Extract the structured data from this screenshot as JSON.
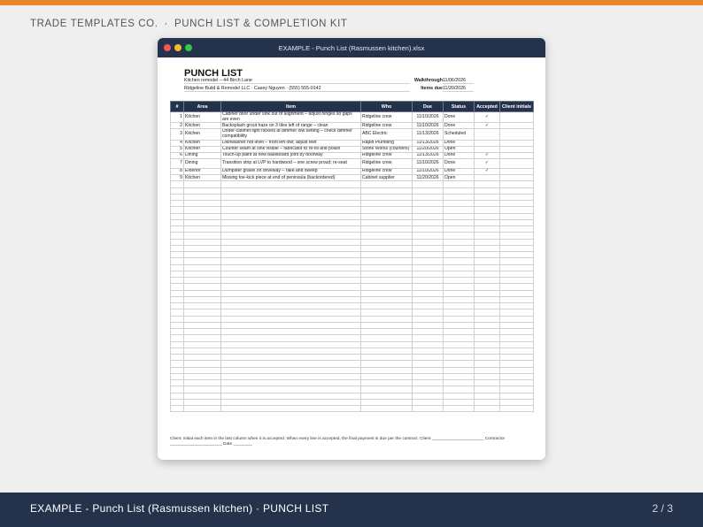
{
  "header": {
    "brand": "TRADE TEMPLATES CO.",
    "separator": "·",
    "kit": "PUNCH LIST & COMPLETION KIT"
  },
  "window": {
    "title": "EXAMPLE - Punch List (Rasmussen kitchen).xlsx"
  },
  "sheet": {
    "title": "PUNCH LIST",
    "project": "Kitchen remodel – 44 Birch Lane",
    "contractor": "Ridgeline Build & Remodel LLC  ·  Casey Nguyen · (555) 555-0142",
    "walkthrough_label": "Walkthrough",
    "walkthrough_value": "11/06/2026",
    "items_due_label": "Items due",
    "items_due_value": "11/20/2026",
    "columns": [
      "#",
      "Area",
      "Item",
      "Who",
      "Due",
      "Status",
      "Accepted",
      "Client initials"
    ],
    "rows": [
      {
        "num": "1",
        "area": "Kitchen",
        "item": "Cabinet door under sink out of alignment – adjust hinges so gaps are even",
        "who": "Ridgeline crew",
        "due": "11/10/2026",
        "status": "Done",
        "accepted": "✓",
        "initials": ""
      },
      {
        "num": "2",
        "area": "Kitchen",
        "item": "Backsplash grout haze on 3 tiles left of range – clean",
        "who": "Ridgeline crew",
        "due": "11/10/2026",
        "status": "Done",
        "accepted": "✓",
        "initials": ""
      },
      {
        "num": "3",
        "area": "Kitchen",
        "item": "Under-cabinet light flickers at dimmer low setting – check dimmer compatibility",
        "who": "ABC Electric",
        "due": "11/13/2026",
        "status": "Scheduled",
        "accepted": "",
        "initials": ""
      },
      {
        "num": "4",
        "area": "Kitchen",
        "item": "Dishwasher not level – front left low; adjust feet",
        "who": "Rapid Plumbing",
        "due": "11/13/2026",
        "status": "Done",
        "accepted": "",
        "initials": ""
      },
      {
        "num": "5",
        "area": "Kitchen",
        "item": "Counter seam at sink visible – fabricator to re-fill and polish",
        "who": "Stone Works (counters)",
        "due": "11/20/2026",
        "status": "Open",
        "accepted": "",
        "initials": ""
      },
      {
        "num": "6",
        "area": "Dining",
        "item": "Touch-up paint at new baseboard joint by doorway",
        "who": "Ridgeline crew",
        "due": "11/13/2026",
        "status": "Done",
        "accepted": "✓",
        "initials": ""
      },
      {
        "num": "7",
        "area": "Dining",
        "item": "Transition strip at LVP to hardwood – one screw proud; re-seat",
        "who": "Ridgeline crew",
        "due": "11/10/2026",
        "status": "Done",
        "accepted": "✓",
        "initials": ""
      },
      {
        "num": "8",
        "area": "Exterior",
        "item": "Dumpster gravel on driveway – rake and sweep",
        "who": "Ridgeline crew",
        "due": "11/10/2026",
        "status": "Done",
        "accepted": "✓",
        "initials": ""
      },
      {
        "num": "9",
        "area": "Kitchen",
        "item": "Missing toe-kick piece at end of peninsula (backordered)",
        "who": "Cabinet supplier",
        "due": "11/20/2026",
        "status": "Open",
        "accepted": "",
        "initials": ""
      }
    ],
    "footnote": "Client: initial each item in the last column when it is accepted. When every line is accepted, the final payment is due per the contract.   Client ______________________   Contractor ______________________   Date ________"
  },
  "footer": {
    "title": "EXAMPLE - Punch List (Rasmussen kitchen) · PUNCH LIST",
    "page": "2 / 3"
  }
}
